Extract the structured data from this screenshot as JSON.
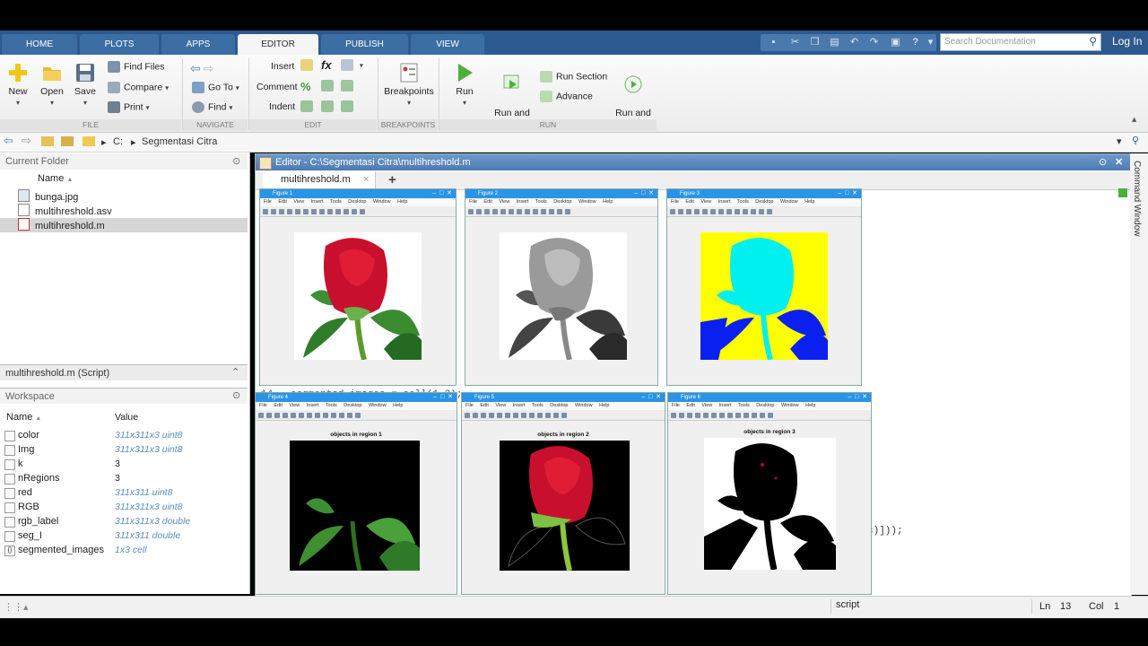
{
  "tabs": [
    "HOME",
    "PLOTS",
    "APPS",
    "EDITOR",
    "PUBLISH",
    "VIEW"
  ],
  "active_tab": "EDITOR",
  "search_placeholder": "Search Documentation",
  "login_label": "Log In",
  "ribbon": {
    "file": {
      "new": "New",
      "open": "Open",
      "save": "Save",
      "find_files": "Find Files",
      "compare": "Compare",
      "print": "Print",
      "section": "FILE"
    },
    "navigate": {
      "go_to": "Go To",
      "find": "Find",
      "section": "NAVIGATE"
    },
    "edit": {
      "insert": "Insert",
      "comment": "Comment",
      "indent": "Indent",
      "fx": "fx",
      "section": "EDIT"
    },
    "breakpoints": {
      "label": "Breakpoints",
      "section": "BREAKPOINTS"
    },
    "run": {
      "run": "Run",
      "run_advance": "Run and\nAdvance",
      "run_section": "Run Section",
      "advance": "Advance",
      "run_time": "Run and\nTime",
      "section": "RUN"
    }
  },
  "path": {
    "drive": "C:",
    "folder": "Segmentasi Citra"
  },
  "current_folder": {
    "title": "Current Folder",
    "column": "Name",
    "files": [
      "bunga.jpg",
      "multihreshold.asv",
      "multihreshold.m"
    ]
  },
  "details_title": "multihreshold.m  (Script)",
  "workspace": {
    "title": "Workspace",
    "col_name": "Name",
    "col_value": "Value",
    "rows": [
      {
        "name": "color",
        "value": "311x311x3 uint8"
      },
      {
        "name": "Img",
        "value": "311x311x3 uint8"
      },
      {
        "name": "k",
        "value": "3"
      },
      {
        "name": "nRegions",
        "value": "3"
      },
      {
        "name": "red",
        "value": "311x311 uint8"
      },
      {
        "name": "RGB",
        "value": "311x311x3 uint8"
      },
      {
        "name": "rgb_label",
        "value": "311x311x3 double"
      },
      {
        "name": "seg_I",
        "value": "311x311 double"
      },
      {
        "name": "segmented_images",
        "value": "1x3 cell"
      }
    ]
  },
  "editor": {
    "title": "Editor - C:\\Segmentasi Citra\\multihreshold.m",
    "tab": "multihreshold.m",
    "code_fragments": [
      "14 -     segmented_images = cell(1,3);",
      "c)]));"
    ]
  },
  "figures": [
    {
      "title": "Figure 1",
      "caption": ""
    },
    {
      "title": "Figure 2",
      "caption": ""
    },
    {
      "title": "Figure 3",
      "caption": ""
    },
    {
      "title": "Figure 4",
      "caption": "objects in region 1"
    },
    {
      "title": "Figure 5",
      "caption": "objects in region 2"
    },
    {
      "title": "Figure 6",
      "caption": "objects in region 3"
    }
  ],
  "figure_menu": "File  Edit  View  Insert  Tools  Desktop  Window  Help",
  "side_panel": "Command Window",
  "status": {
    "mode": "script",
    "ln_label": "Ln",
    "ln": "13",
    "col_label": "Col",
    "col": "1"
  }
}
